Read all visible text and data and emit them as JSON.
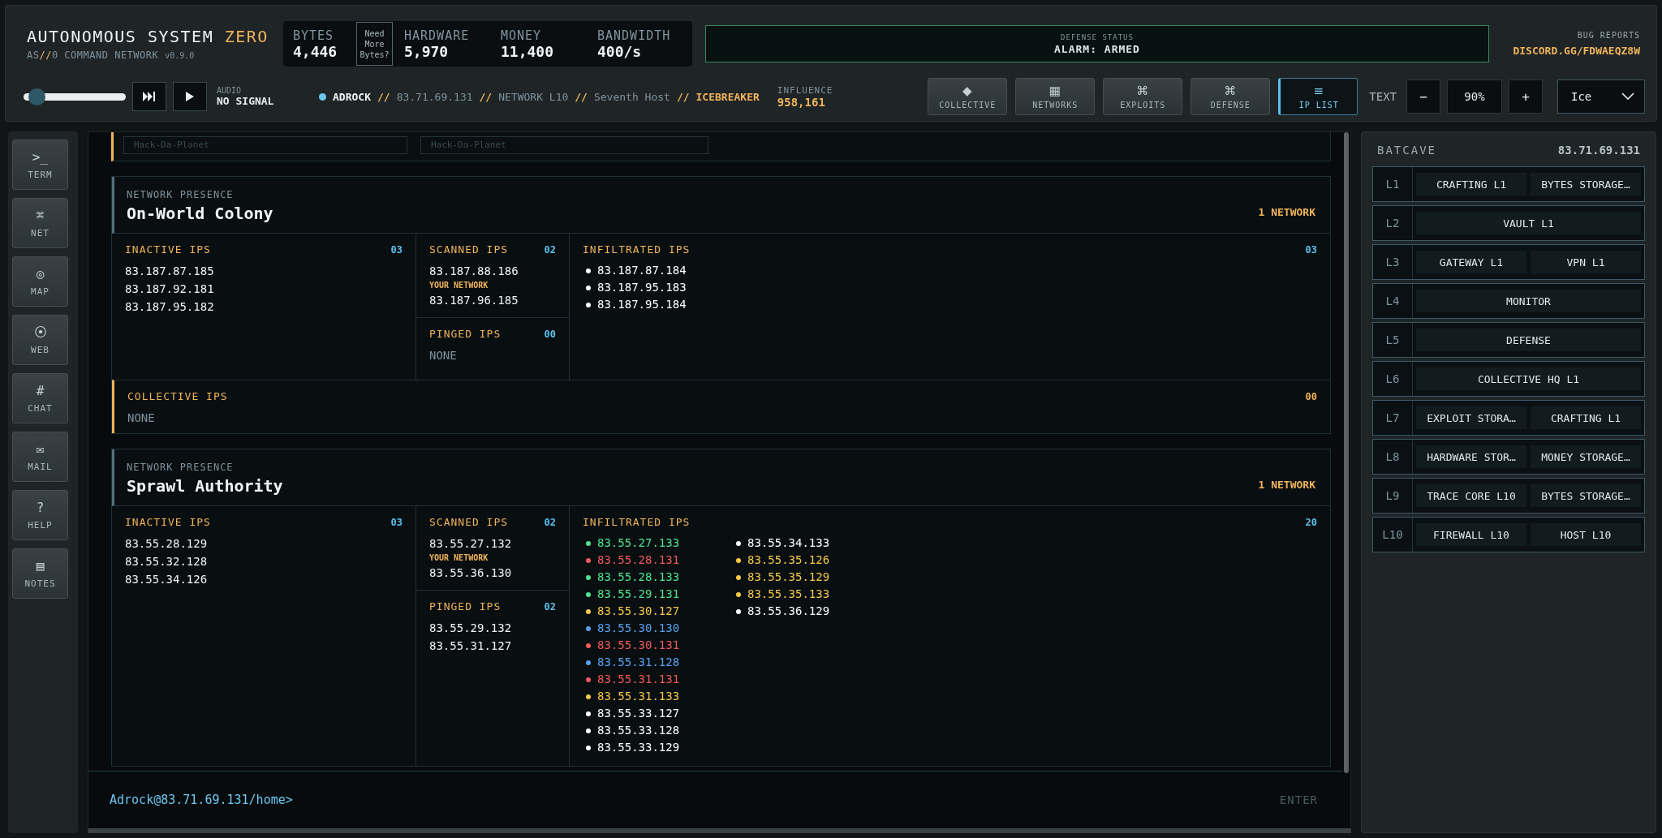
{
  "header": {
    "title": {
      "main": "AUTONOMOUS SYSTEM",
      "accent": "ZERO"
    },
    "subtitle": {
      "prefix": "AS",
      "mark": "//",
      "rest": "0 COMMAND NETWORK"
    },
    "version": "v0.9.0",
    "stats": [
      {
        "label": "BYTES",
        "value": "4,446"
      },
      {
        "label": "HARDWARE",
        "value": "5,970"
      },
      {
        "label": "MONEY",
        "value": "11,400"
      },
      {
        "label": "BANDWIDTH",
        "value": "400/s"
      }
    ],
    "more_button": "Need More Bytes?",
    "defense": {
      "label": "DEFENSE STATUS",
      "value": "ALARM: ARMED"
    },
    "bug_reports": {
      "label": "BUG REPORTS",
      "link": "DISCORD.GG/FDWAEQZ8W"
    }
  },
  "player": {
    "volume": {
      "level": 0.08
    },
    "audio_label": "AUDIO",
    "audio_status": "NO SIGNAL"
  },
  "location": [
    {
      "text": "ADROCK",
      "kind": "user"
    },
    {
      "text": "//",
      "kind": "sep"
    },
    {
      "text": "83.71.69.131",
      "kind": "plain"
    },
    {
      "text": "//",
      "kind": "sep"
    },
    {
      "text": "NETWORK L10",
      "kind": "plain"
    },
    {
      "text": "//",
      "kind": "sep"
    },
    {
      "text": "Seventh Host",
      "kind": "plain"
    },
    {
      "text": "//",
      "kind": "sep"
    },
    {
      "text": "ICEBREAKER",
      "kind": "highlight"
    }
  ],
  "influence": {
    "label": "INFLUENCE",
    "value": "958,161"
  },
  "nav": [
    {
      "icon": "◆",
      "label": "COLLECTIVE",
      "selected": false
    },
    {
      "icon": "▦",
      "label": "NETWORKS",
      "selected": false
    },
    {
      "icon": "⌘",
      "label": "EXPLOITS",
      "selected": false
    },
    {
      "icon": "⌘",
      "label": "DEFENSE",
      "selected": false
    },
    {
      "icon": "≡",
      "label": "IP LIST",
      "selected": true
    }
  ],
  "text_size": {
    "label": "TEXT",
    "minus": "−",
    "value": "90%",
    "plus": "+"
  },
  "theme_select": {
    "value": "Ice"
  },
  "sidebar": [
    {
      "icon": ">_",
      "label": "TERM"
    },
    {
      "icon": "⌘",
      "label": "NET"
    },
    {
      "icon": "◎",
      "label": "MAP"
    },
    {
      "icon": "⦿",
      "label": "WEB"
    },
    {
      "icon": "#",
      "label": "CHAT"
    },
    {
      "icon": "✉",
      "label": "MAIL"
    },
    {
      "icon": "?",
      "label": "HELP"
    },
    {
      "icon": "▤",
      "label": "NOTES"
    }
  ],
  "top_fields": [
    "Hack-Da-Planet",
    "Hack-Da-Planet"
  ],
  "networks": [
    {
      "eyebrow": "NETWORK PRESENCE",
      "name": "On-World Colony",
      "count": "1 NETWORK",
      "inactive": {
        "title": "INACTIVE IPS",
        "count": "03",
        "ips": [
          "83.187.87.185",
          "83.187.92.181",
          "83.187.95.182"
        ]
      },
      "scanned": {
        "title": "SCANNED IPS",
        "count": "02",
        "ips": [
          {
            "ip": "83.187.88.186",
            "note": "YOUR NETWORK"
          },
          {
            "ip": "83.187.96.185"
          }
        ]
      },
      "pinged": {
        "title": "PINGED IPS",
        "count": "00",
        "empty": "NONE"
      },
      "infiltrated": {
        "title": "INFILTRATED IPS",
        "count": "03",
        "ips": [
          {
            "ip": "83.187.87.184",
            "color": "#ffffff"
          },
          {
            "ip": "83.187.95.183",
            "color": "#ffffff"
          },
          {
            "ip": "83.187.95.184",
            "color": "#ffffff"
          }
        ]
      },
      "collective": {
        "title": "COLLECTIVE IPS",
        "count": "00",
        "empty": "NONE"
      }
    },
    {
      "eyebrow": "NETWORK PRESENCE",
      "name": "Sprawl Authority",
      "count": "1 NETWORK",
      "inactive": {
        "title": "INACTIVE IPS",
        "count": "03",
        "ips": [
          "83.55.28.129",
          "83.55.32.128",
          "83.55.34.126"
        ]
      },
      "scanned": {
        "title": "SCANNED IPS",
        "count": "02",
        "ips": [
          {
            "ip": "83.55.27.132",
            "note": "YOUR NETWORK"
          },
          {
            "ip": "83.55.36.130"
          }
        ]
      },
      "pinged": {
        "title": "PINGED IPS",
        "count": "02",
        "ips": [
          "83.55.29.132",
          "83.55.31.127"
        ]
      },
      "infiltrated": {
        "title": "INFILTRATED IPS",
        "count": "20",
        "ips": [
          {
            "ip": "83.55.27.133",
            "color": "#4ee38f"
          },
          {
            "ip": "83.55.28.131",
            "color": "#f05a5a"
          },
          {
            "ip": "83.55.28.133",
            "color": "#4ee38f"
          },
          {
            "ip": "83.55.29.131",
            "color": "#4ee38f"
          },
          {
            "ip": "83.55.30.127",
            "color": "#f7c948"
          },
          {
            "ip": "83.55.30.130",
            "color": "#5aa2f0"
          },
          {
            "ip": "83.55.30.131",
            "color": "#f05a5a"
          },
          {
            "ip": "83.55.31.128",
            "color": "#5aa2f0"
          },
          {
            "ip": "83.55.31.131",
            "color": "#f05a5a"
          },
          {
            "ip": "83.55.31.133",
            "color": "#f7c948"
          },
          {
            "ip": "83.55.33.127",
            "color": "#ffffff"
          },
          {
            "ip": "83.55.33.128",
            "color": "#ffffff"
          },
          {
            "ip": "83.55.33.129",
            "color": "#ffffff"
          },
          {
            "ip": "83.55.34.133",
            "color": "#ffffff"
          },
          {
            "ip": "83.55.35.126",
            "color": "#f7c948"
          },
          {
            "ip": "83.55.35.129",
            "color": "#f7c948"
          },
          {
            "ip": "83.55.35.133",
            "color": "#f7c948"
          },
          {
            "ip": "83.55.36.129",
            "color": "#ffffff"
          }
        ]
      }
    }
  ],
  "terminal": {
    "prompt": "Adrock@83.71.69.131/home>",
    "enter": "ENTER"
  },
  "base": {
    "name": "BATCAVE",
    "ip": "83.71.69.131",
    "levels": [
      {
        "label": "L1",
        "slots": [
          "CRAFTING L1",
          "BYTES STORAGE…"
        ]
      },
      {
        "label": "L2",
        "slots": [
          "VAULT L1"
        ]
      },
      {
        "label": "L3",
        "slots": [
          "GATEWAY L1",
          "VPN L1"
        ]
      },
      {
        "label": "L4",
        "slots": [
          "MONITOR"
        ]
      },
      {
        "label": "L5",
        "slots": [
          "DEFENSE"
        ]
      },
      {
        "label": "L6",
        "slots": [
          "COLLECTIVE HQ L1"
        ]
      },
      {
        "label": "L7",
        "slots": [
          "EXPLOIT STORA…",
          "CRAFTING L1"
        ]
      },
      {
        "label": "L8",
        "slots": [
          "HARDWARE STOR…",
          "MONEY STORAGE…"
        ]
      },
      {
        "label": "L9",
        "slots": [
          "TRACE CORE L10",
          "BYTES STORAGE…"
        ]
      },
      {
        "label": "L10",
        "slots": [
          "FIREWALL L10",
          "HOST L10"
        ]
      }
    ]
  }
}
